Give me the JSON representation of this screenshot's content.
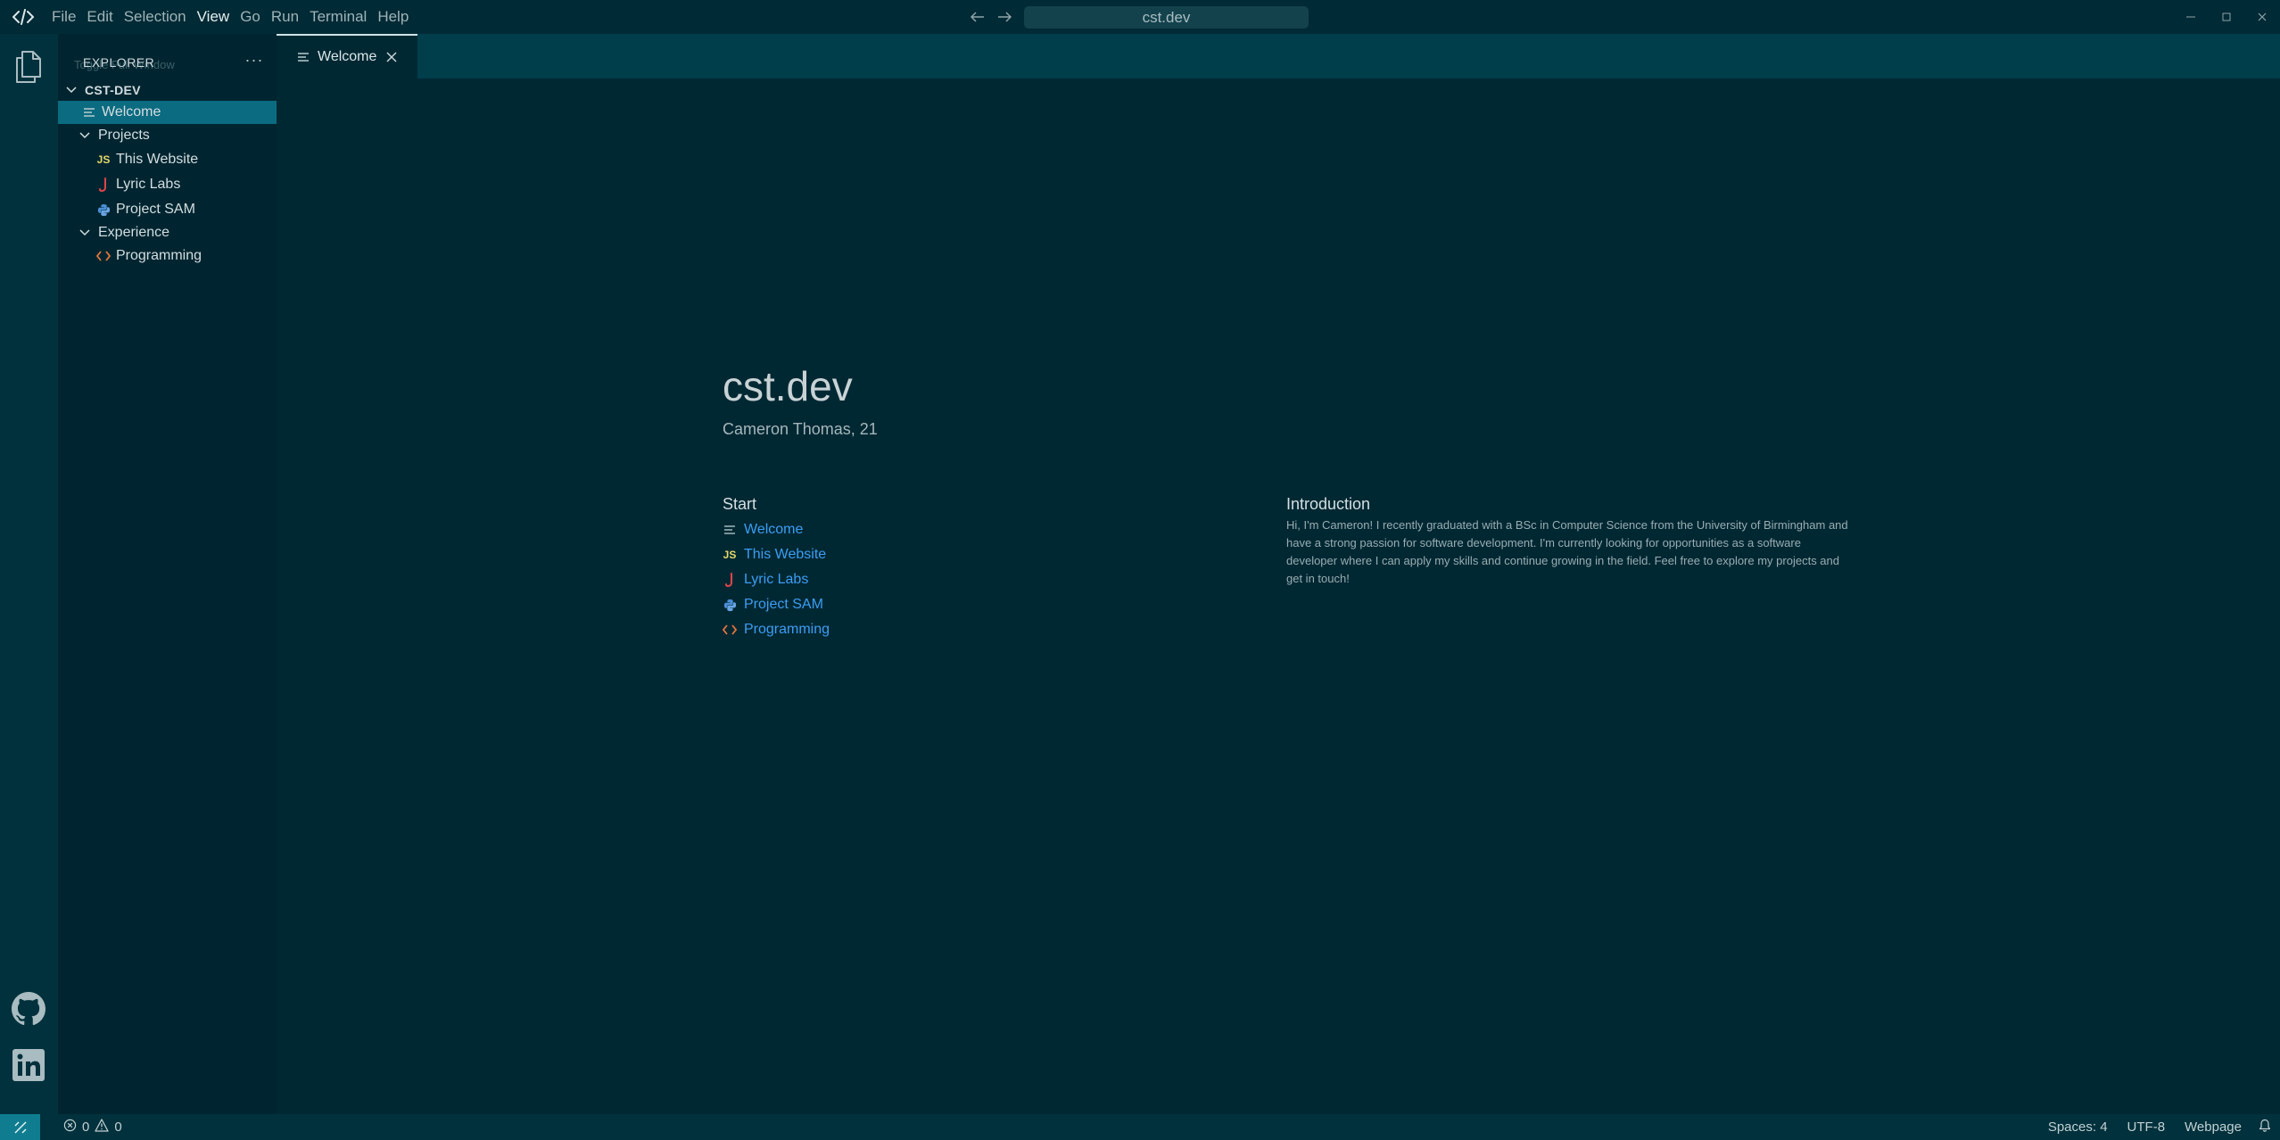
{
  "titlebar": {
    "menu": [
      "File",
      "Edit",
      "Selection",
      "View",
      "Go",
      "Run",
      "Terminal",
      "Help"
    ],
    "active_menu": "View",
    "search_text": "cst.dev",
    "window_controls": [
      "minimize-icon",
      "maximize-icon",
      "close-icon"
    ]
  },
  "activitybar": {
    "top": [
      "explorer-icon"
    ],
    "bottom": [
      "github-icon",
      "linkedin-icon"
    ]
  },
  "sidebar": {
    "title": "EXPLORER",
    "ghost_text": "Toggle Full Window",
    "root_label": "CST-DEV",
    "items": {
      "welcome": "Welcome",
      "projects": "Projects",
      "this_website": "This Website",
      "lyric_labs": "Lyric Labs",
      "project_sam": "Project SAM",
      "experience": "Experience",
      "programming": "Programming"
    },
    "icon_badges": {
      "js": "JS"
    }
  },
  "tab": {
    "label": "Welcome"
  },
  "main": {
    "title": "cst.dev",
    "subtitle": "Cameron Thomas, 21",
    "start": {
      "heading": "Start",
      "links": [
        "Welcome",
        "This Website",
        "Lyric Labs",
        "Project SAM",
        "Programming"
      ]
    },
    "intro": {
      "heading": "Introduction",
      "text": "Hi, I'm Cameron! I recently graduated with a BSc in Computer Science from the University of Birmingham and have a strong passion for software development. I'm currently looking for opportunities as a software developer where I can apply my skills and continue growing in the field. Feel free to explore my projects and get in touch!"
    }
  },
  "statusbar": {
    "errors": "0",
    "warnings": "0",
    "spaces": "Spaces: 4",
    "encoding": "UTF-8",
    "language": "Webpage"
  },
  "colors": {
    "background": "#002833",
    "sidebar": "#002530",
    "selection": "#0b6b80",
    "link": "#3d9df3",
    "js_badge": "#e6d96a",
    "java_icon": "#e0454a",
    "python_icon": "#4a8fd6",
    "html_icon": "#e0763c"
  }
}
